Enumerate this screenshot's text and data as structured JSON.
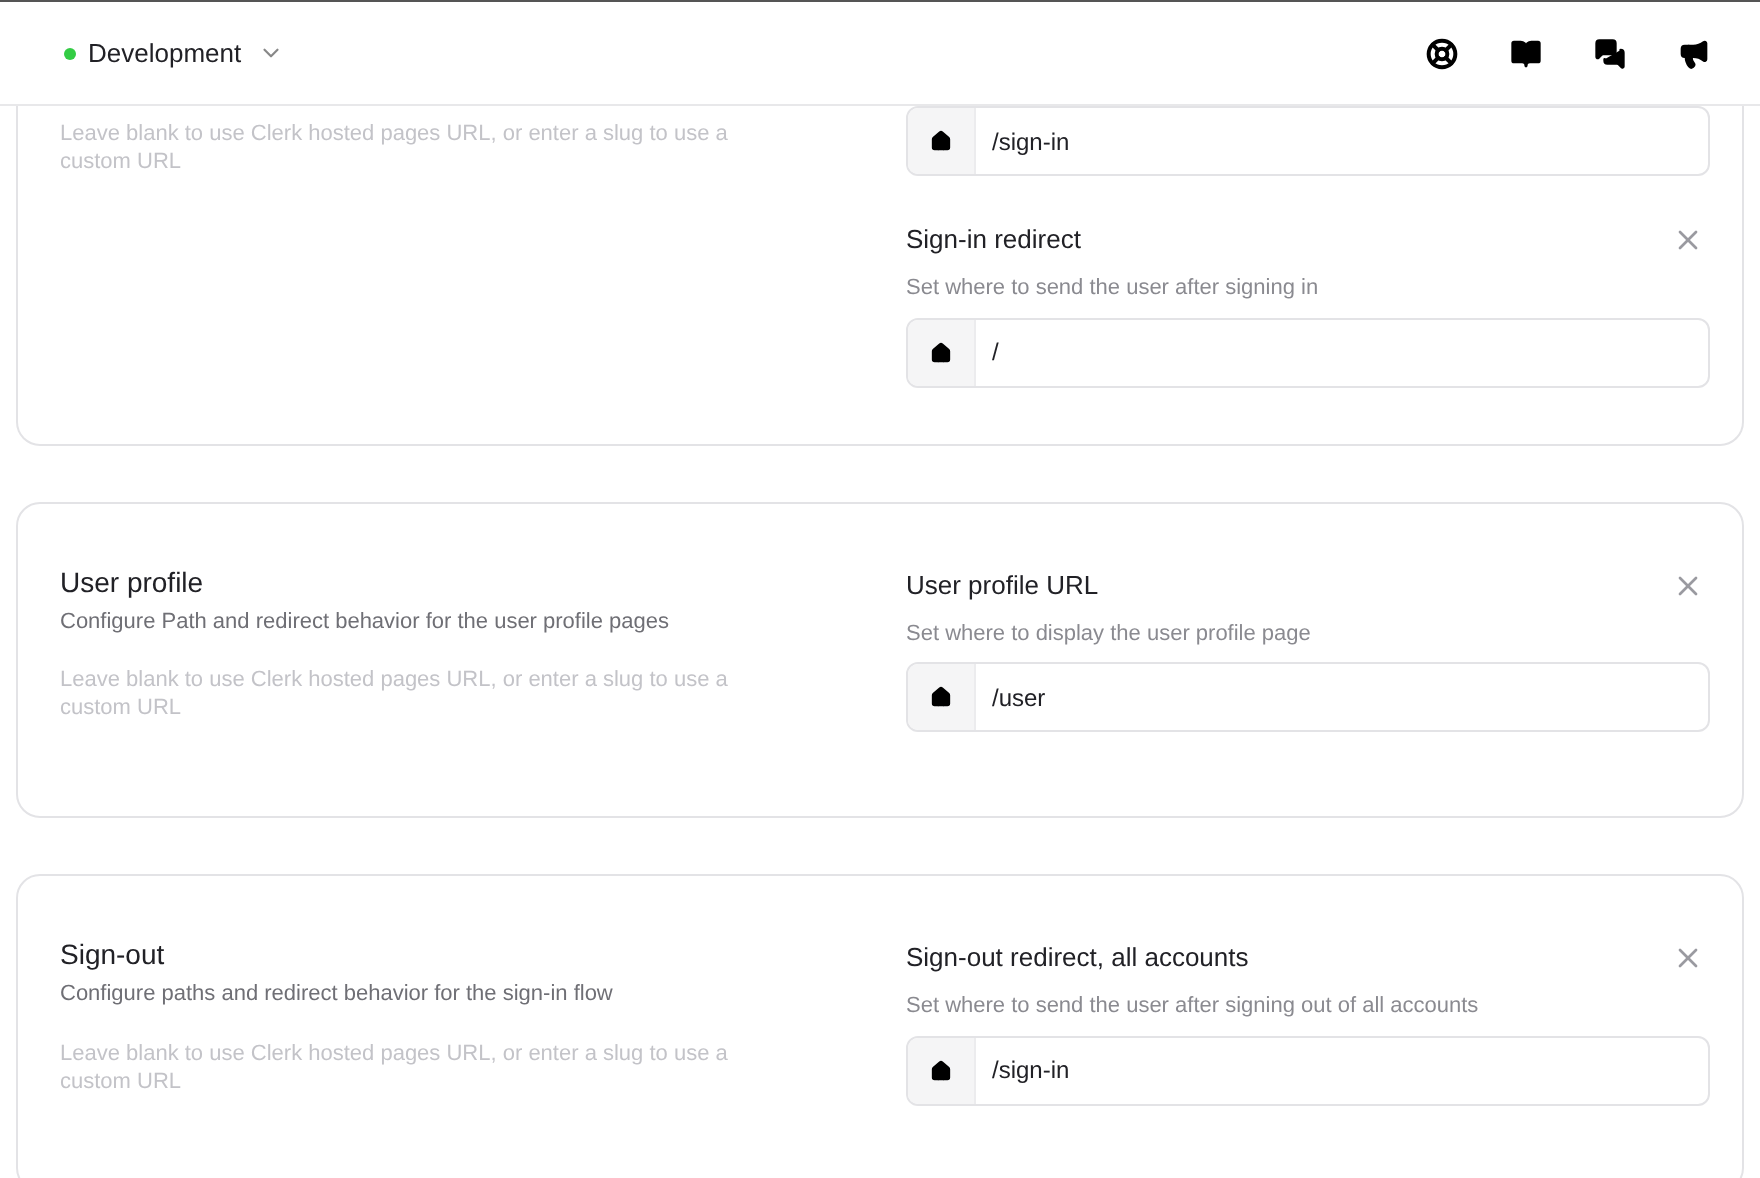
{
  "header": {
    "environment": "Development"
  },
  "sections": [
    {
      "hint": "Leave blank to use Clerk hosted pages URL, or enter a slug to use a custom URL",
      "fields": [
        {
          "value": "/sign-in"
        },
        {
          "label": "Sign-in redirect",
          "description": "Set where to send the user after signing in",
          "value": "/"
        }
      ]
    },
    {
      "title": "User profile",
      "description": "Configure Path and redirect behavior for the user profile pages",
      "hint": "Leave blank to use Clerk hosted pages URL, or enter a slug to use a custom URL",
      "fields": [
        {
          "label": "User profile URL",
          "description": "Set where to display the user profile page",
          "value": "/user"
        }
      ]
    },
    {
      "title": "Sign-out",
      "description": "Configure paths and redirect behavior for the sign-in flow",
      "hint": "Leave blank to use Clerk hosted pages URL, or enter a slug to use a custom URL",
      "fields": [
        {
          "label": "Sign-out redirect, all accounts",
          "description": "Set where to send the user after signing out of all accounts",
          "value": "/sign-in"
        }
      ]
    }
  ]
}
